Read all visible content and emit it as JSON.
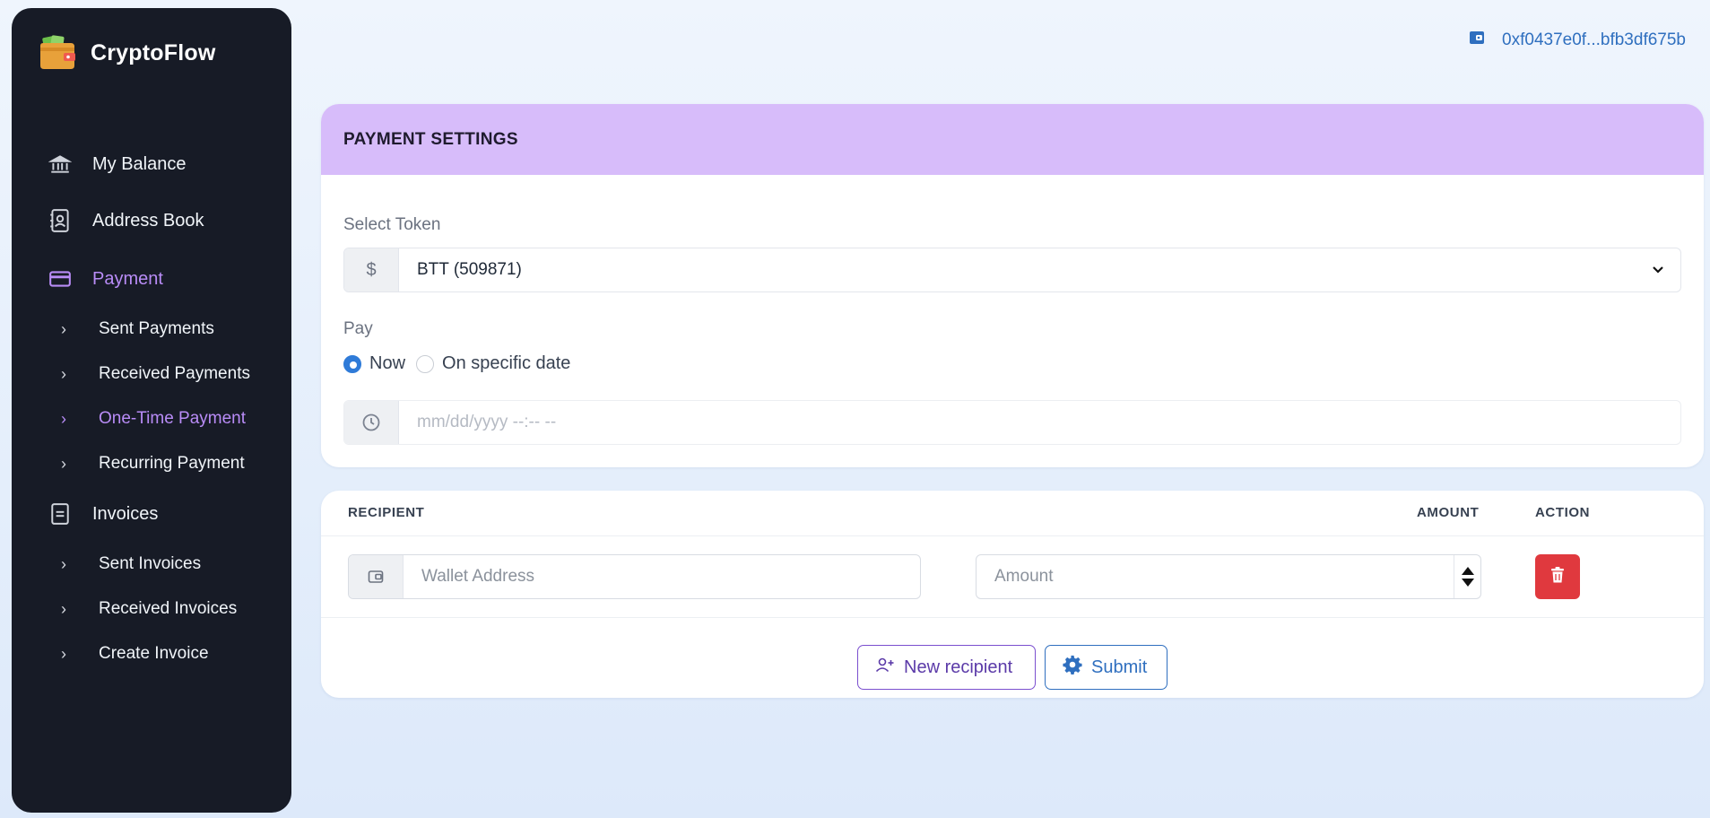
{
  "app": {
    "name": "CryptoFlow"
  },
  "wallet": {
    "address": "0xf0437e0f...bfb3df675b"
  },
  "sidebar": {
    "items": [
      {
        "label": "My Balance"
      },
      {
        "label": "Address Book"
      },
      {
        "label": "Payment"
      },
      {
        "label": "Invoices"
      }
    ],
    "payment_sub": [
      {
        "label": "Sent Payments"
      },
      {
        "label": "Received Payments"
      },
      {
        "label": "One-Time Payment"
      },
      {
        "label": "Recurring Payment"
      }
    ],
    "invoice_sub": [
      {
        "label": "Sent Invoices"
      },
      {
        "label": "Received Invoices"
      },
      {
        "label": "Create Invoice"
      }
    ],
    "active_item": "Payment",
    "active_sub": "One-Time Payment"
  },
  "settings": {
    "title": "PAYMENT SETTINGS",
    "token_label": "Select Token",
    "token_addon": "$",
    "token_value": "BTT (509871)",
    "pay_label": "Pay",
    "pay_options": [
      {
        "label": "Now",
        "checked": true
      },
      {
        "label": "On specific date",
        "checked": false
      }
    ],
    "date_placeholder": "mm/dd/yyyy --:-- --"
  },
  "recipients": {
    "headers": {
      "recipient": "RECIPIENT",
      "amount": "AMOUNT",
      "action": "ACTION"
    },
    "wallet_placeholder": "Wallet Address",
    "amount_placeholder": "Amount"
  },
  "buttons": {
    "new_recipient": "New recipient",
    "submit": "Submit"
  },
  "colors": {
    "accent_purple": "#b98cf7",
    "header_purple": "#d7bcfa",
    "sidebar_bg": "#171b26",
    "link_blue": "#2f6fbf",
    "danger": "#e0393e"
  }
}
